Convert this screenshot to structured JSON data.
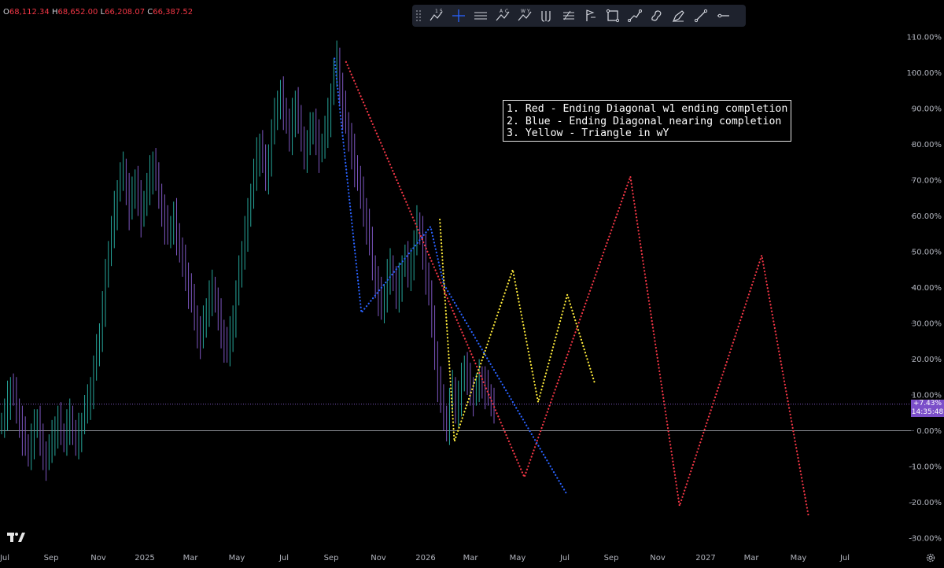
{
  "ohlc": {
    "o_label": "O",
    "o": "68,112.34",
    "h_label": "H",
    "h": "68,652.00",
    "l_label": "L",
    "l": "66,208.07",
    "c_label": "C",
    "c": "66,387.52"
  },
  "toolbar": {
    "tools": [
      "elliott-numbers-tool",
      "crosshair-tool",
      "parallel-lines-tool",
      "abc-wave-tool",
      "wxy-wave-tool",
      "fork-tool",
      "fib-tool",
      "price-range-tool",
      "rectangle-tool",
      "path-tool",
      "brush-tool",
      "pen-tool",
      "trend-line-tool",
      "horizontal-ray-tool"
    ],
    "labels": {
      "wave_1": "1",
      "wave_5": "5",
      "wave_a": "A",
      "wave_c": "C",
      "wave_w": "W",
      "wave_y": "Y"
    }
  },
  "legend": {
    "line1": "1. Red - Ending Diagonal w1 ending completion",
    "line2": "2. Blue - Ending Diagonal nearing completion",
    "line3": "3. Yellow - Triangle in wY"
  },
  "price_badge": {
    "change": "+7.43%",
    "countdown": "14:35:48"
  },
  "colors": {
    "background": "#000000",
    "red_path": "#f23645",
    "blue_path": "#2962ff",
    "yellow_path": "#ffeb3b",
    "candle_up": "#26a69a",
    "candle_down": "#7e57c2",
    "badge": "#7b4fc9"
  },
  "chart_data": {
    "type": "line",
    "title": "",
    "xlabel": "",
    "ylabel": "",
    "y_axis": {
      "unit": "%",
      "scale": "linear",
      "range": [
        -30,
        110
      ],
      "ticks": [
        "110.00%",
        "100.00%",
        "90.00%",
        "80.00%",
        "70.00%",
        "60.00%",
        "50.00%",
        "40.00%",
        "30.00%",
        "20.00%",
        "10.00%",
        "0.00%",
        "-10.00%",
        "-20.00%",
        "-30.00%"
      ]
    },
    "x_axis": {
      "ticks": [
        "Jul",
        "Sep",
        "Nov",
        "2025",
        "Mar",
        "May",
        "Jul",
        "Sep",
        "Nov",
        "2026",
        "Mar",
        "May",
        "Jul",
        "Sep",
        "Nov",
        "2027",
        "Mar",
        "May",
        "Jul"
      ]
    },
    "grid": false,
    "zero_line": 0,
    "current_value_line": 7.43,
    "price_series": {
      "name": "",
      "y": [
        2,
        5,
        9,
        12,
        10,
        6,
        3,
        -1,
        -4,
        -6,
        -2,
        1,
        3,
        -3,
        -6,
        -8,
        -5,
        -2,
        1,
        3,
        -1,
        -2,
        2,
        4,
        -1,
        -3,
        0,
        2,
        6,
        8,
        12,
        17,
        22,
        27,
        35,
        43,
        50,
        56,
        62,
        67,
        71,
        73,
        68,
        62,
        66,
        70,
        65,
        60,
        64,
        68,
        72,
        75,
        70,
        66,
        62,
        58,
        55,
        57,
        60,
        55,
        50,
        47,
        44,
        40,
        36,
        32,
        28,
        26,
        30,
        34,
        38,
        40,
        36,
        32,
        28,
        25,
        22,
        27,
        32,
        38,
        44,
        50,
        56,
        60,
        66,
        72,
        77,
        80,
        75,
        71,
        77,
        83,
        88,
        92,
        94,
        90,
        86,
        82,
        88,
        92,
        86,
        82,
        78,
        80,
        84,
        86,
        82,
        78,
        80,
        84,
        88,
        94,
        100,
        104,
        96,
        90,
        86,
        82,
        78,
        74,
        70,
        66,
        62,
        58,
        52,
        46,
        42,
        38,
        34,
        38,
        44,
        46,
        42,
        38,
        42,
        46,
        48,
        44,
        48,
        52,
        58,
        56,
        50,
        44,
        38,
        30,
        22,
        14,
        8,
        4,
        2,
        8,
        12,
        6,
        10,
        14,
        18,
        14,
        12,
        10,
        12,
        15,
        14,
        12,
        10,
        8,
        7
      ]
    },
    "series": [
      {
        "name": "Red - Ending Diagonal w1 ending completion",
        "color": "#f23645",
        "points": [
          [
            "2025-09-20",
            103
          ],
          [
            "2026-05-10",
            -13
          ],
          [
            "2026-09-25",
            71
          ],
          [
            "2026-11-28",
            -21
          ],
          [
            "2027-03-15",
            49
          ],
          [
            "2027-05-15",
            -24
          ]
        ]
      },
      {
        "name": "Blue - Ending Diagonal nearing completion",
        "color": "#2962ff",
        "points": [
          [
            "2025-09-05",
            104
          ],
          [
            "2025-10-10",
            33
          ],
          [
            "2026-01-08",
            57
          ],
          [
            "2026-01-25",
            41
          ],
          [
            "2026-07-05",
            -18
          ]
        ]
      },
      {
        "name": "Yellow - Triangle in wY",
        "color": "#ffeb3b",
        "points": [
          [
            "2026-01-20",
            59
          ],
          [
            "2026-02-08",
            -3
          ],
          [
            "2026-04-25",
            45
          ],
          [
            "2026-05-28",
            8
          ],
          [
            "2026-07-05",
            38
          ],
          [
            "2026-08-10",
            13
          ]
        ]
      }
    ]
  }
}
